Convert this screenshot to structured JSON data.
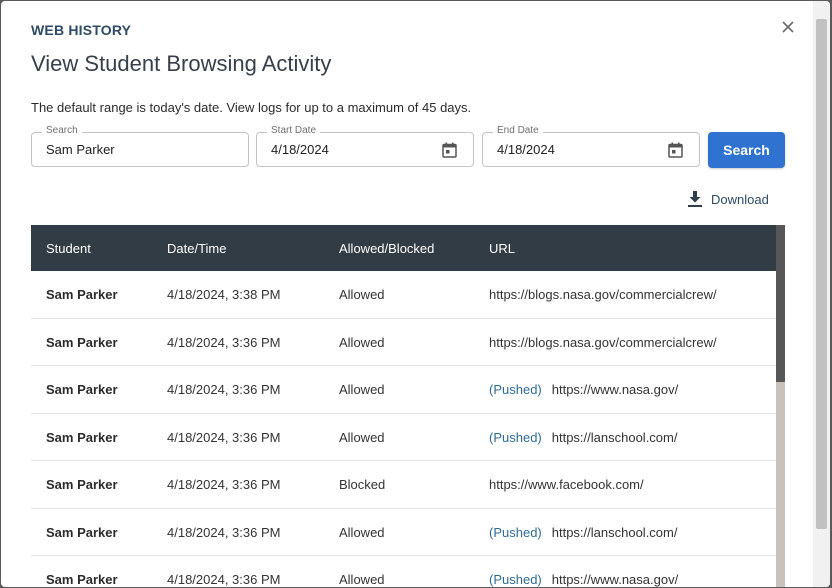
{
  "header": {
    "overline": "WEB HISTORY",
    "title": "View Student Browsing Activity",
    "hint": "The default range is today's date. View logs for up to a maximum of 45 days."
  },
  "filters": {
    "search": {
      "label": "Search",
      "value": "Sam Parker"
    },
    "start_date": {
      "label": "Start Date",
      "value": "4/18/2024"
    },
    "end_date": {
      "label": "End Date",
      "value": "4/18/2024"
    },
    "search_button": "Search"
  },
  "download": {
    "label": "Download",
    "icon": "download-icon"
  },
  "table": {
    "columns": [
      "Student",
      "Date/Time",
      "Allowed/Blocked",
      "URL"
    ],
    "rows": [
      {
        "student": "Sam Parker",
        "datetime": "4/18/2024, 3:38 PM",
        "status": "Allowed",
        "pushed": "",
        "url": "https://blogs.nasa.gov/commercialcrew/"
      },
      {
        "student": "Sam Parker",
        "datetime": "4/18/2024, 3:36 PM",
        "status": "Allowed",
        "pushed": "",
        "url": "https://blogs.nasa.gov/commercialcrew/"
      },
      {
        "student": "Sam Parker",
        "datetime": "4/18/2024, 3:36 PM",
        "status": "Allowed",
        "pushed": "(Pushed)",
        "url": "https://www.nasa.gov/"
      },
      {
        "student": "Sam Parker",
        "datetime": "4/18/2024, 3:36 PM",
        "status": "Allowed",
        "pushed": "(Pushed)",
        "url": "https://lanschool.com/"
      },
      {
        "student": "Sam Parker",
        "datetime": "4/18/2024, 3:36 PM",
        "status": "Blocked",
        "pushed": "",
        "url": "https://www.facebook.com/"
      },
      {
        "student": "Sam Parker",
        "datetime": "4/18/2024, 3:36 PM",
        "status": "Allowed",
        "pushed": "(Pushed)",
        "url": "https://lanschool.com/"
      },
      {
        "student": "Sam Parker",
        "datetime": "4/18/2024, 3:36 PM",
        "status": "Allowed",
        "pushed": "(Pushed)",
        "url": "https://www.nasa.gov/"
      }
    ]
  },
  "colors": {
    "accent": "#2f72cf",
    "table_header": "#323c45",
    "pushed_text": "#2f6a94"
  }
}
